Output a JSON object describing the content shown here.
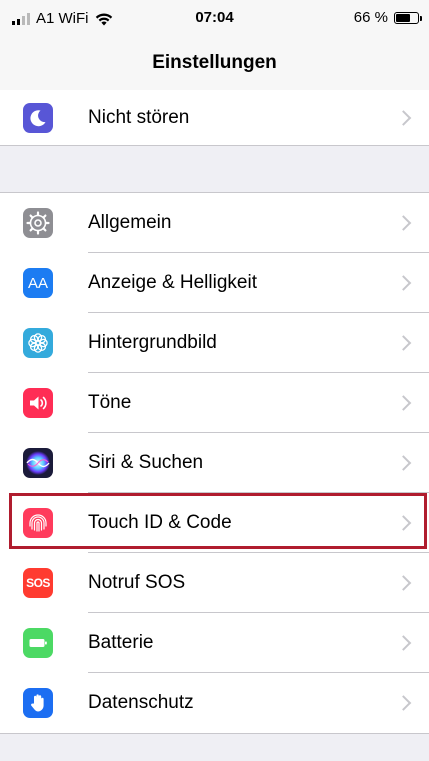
{
  "status": {
    "carrier": "A1 WiFi",
    "time": "07:04",
    "battery": "66 %",
    "battery_level": 0.66
  },
  "nav": {
    "title": "Einstellungen"
  },
  "group_top": [
    {
      "label": "Nicht stören",
      "icon": "moon-icon",
      "color": "#5856d6"
    }
  ],
  "group_main": [
    {
      "label": "Allgemein",
      "icon": "gear-icon",
      "color": "#8e8e93"
    },
    {
      "label": "Anzeige & Helligkeit",
      "icon": "text-size-icon",
      "icon_text": "AA",
      "color": "#1c7cf2"
    },
    {
      "label": "Hintergrundbild",
      "icon": "flower-icon",
      "color": "#34aadc"
    },
    {
      "label": "Töne",
      "icon": "speaker-icon",
      "color": "#ff2d55"
    },
    {
      "label": "Siri & Suchen",
      "icon": "siri-icon",
      "color": "#1b1b3a"
    },
    {
      "label": "Touch ID & Code",
      "icon": "fingerprint-icon",
      "color": "#ff3b5c",
      "highlighted": true
    },
    {
      "label": "Notruf SOS",
      "icon": "sos-icon",
      "icon_text": "SOS",
      "color": "#ff3b30"
    },
    {
      "label": "Batterie",
      "icon": "battery-icon",
      "color": "#4cd964"
    },
    {
      "label": "Datenschutz",
      "icon": "hand-icon",
      "color": "#1c6ef2"
    }
  ]
}
